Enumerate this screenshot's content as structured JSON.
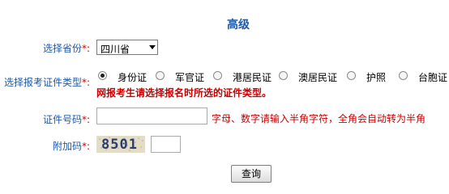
{
  "title": "高级",
  "province": {
    "label": "选择省份",
    "required_mark": "*:",
    "selected": "四川省"
  },
  "id_type": {
    "label": "选择报考证件类型",
    "required_mark": "*:",
    "options": [
      {
        "label": "身份证",
        "checked": true
      },
      {
        "label": "军官证",
        "checked": false
      },
      {
        "label": "港居民证",
        "checked": false
      },
      {
        "label": "澳居民证",
        "checked": false
      },
      {
        "label": "护照",
        "checked": false
      },
      {
        "label": "台胞证",
        "checked": false
      }
    ],
    "warning": "网报考生请选择报名时所选的证件类型。"
  },
  "id_number": {
    "label": "证件号码",
    "required_mark": "*:",
    "value": "",
    "hint": "字母、数字请输入半角字符，全角会自动转为半角"
  },
  "captcha": {
    "label": "附加码",
    "required_mark": "*:",
    "code": "8501",
    "value": ""
  },
  "submit_label": "查询",
  "colors": {
    "label_blue": "#1e5aa8",
    "required_red": "#cc0000"
  }
}
